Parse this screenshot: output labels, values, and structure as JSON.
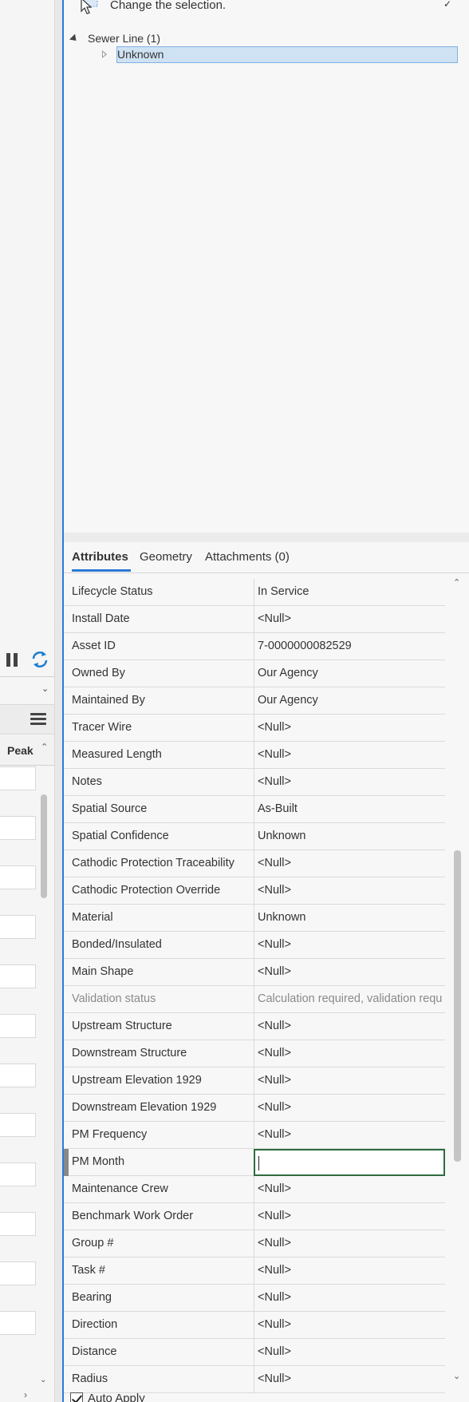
{
  "selection": {
    "prompt": "Change the selection.",
    "tree_root": "Sewer Line (1)",
    "tree_child": "Unknown"
  },
  "tabs": [
    {
      "label": "Attributes"
    },
    {
      "label": "Geometry"
    },
    {
      "label": "Attachments (0)"
    }
  ],
  "left_table": {
    "column_header": "Peak"
  },
  "attributes": [
    {
      "label": "Lifecycle Status",
      "value": "In Service"
    },
    {
      "label": "Install Date",
      "value": "<Null>"
    },
    {
      "label": "Asset ID",
      "value": "7-0000000082529"
    },
    {
      "label": "Owned By",
      "value": "Our Agency"
    },
    {
      "label": "Maintained By",
      "value": "Our Agency"
    },
    {
      "label": "Tracer Wire",
      "value": "<Null>"
    },
    {
      "label": "Measured Length",
      "value": "<Null>"
    },
    {
      "label": "Notes",
      "value": "<Null>"
    },
    {
      "label": "Spatial Source",
      "value": "As-Built"
    },
    {
      "label": "Spatial Confidence",
      "value": "Unknown"
    },
    {
      "label": "Cathodic Protection Traceability",
      "value": "<Null>"
    },
    {
      "label": "Cathodic Protection Override",
      "value": "<Null>"
    },
    {
      "label": "Material",
      "value": "Unknown"
    },
    {
      "label": "Bonded/Insulated",
      "value": "<Null>"
    },
    {
      "label": "Main Shape",
      "value": "<Null>"
    },
    {
      "label": "Validation status",
      "value": "Calculation required, validation requ",
      "disabled": true
    },
    {
      "label": "Upstream Structure",
      "value": "<Null>"
    },
    {
      "label": "Downstream Structure",
      "value": "<Null>"
    },
    {
      "label": "Upstream Elevation 1929",
      "value": "<Null>"
    },
    {
      "label": "Downstream Elevation 1929",
      "value": "<Null>"
    },
    {
      "label": "PM Frequency",
      "value": "<Null>"
    },
    {
      "label": "PM Month",
      "value": "",
      "editing": true
    },
    {
      "label": "Maintenance Crew",
      "value": "<Null>"
    },
    {
      "label": "Benchmark Work Order",
      "value": "<Null>"
    },
    {
      "label": "Group #",
      "value": "<Null>"
    },
    {
      "label": "Task #",
      "value": "<Null>"
    },
    {
      "label": "Bearing",
      "value": "<Null>"
    },
    {
      "label": "Direction",
      "value": "<Null>"
    },
    {
      "label": "Distance",
      "value": "<Null>"
    },
    {
      "label": "Radius",
      "value": "<Null>"
    }
  ],
  "auto_apply": {
    "label": "Auto Apply",
    "checked": true
  },
  "colors": {
    "accent": "#2b7bd6",
    "selection_bg": "#cfe2f3",
    "editor_border": "#2e6b3e"
  }
}
